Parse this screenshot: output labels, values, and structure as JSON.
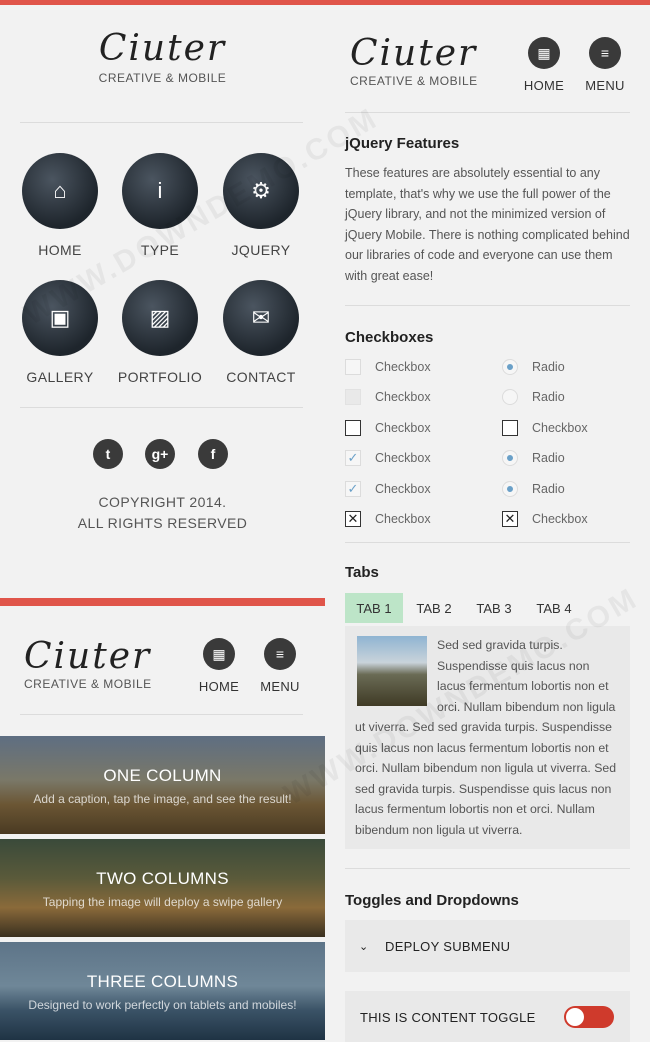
{
  "brand": {
    "logo": "Ciuter",
    "tagline": "CREATIVE & MOBILE"
  },
  "colors": {
    "accent": "#e0554a",
    "dark": "#3a3a3a",
    "tab_active": "#bde5c8",
    "toggle_on": "#cf3a2c",
    "check": "#6aa0c8"
  },
  "menu_tiles": [
    {
      "label": "HOME",
      "icon": "home-icon",
      "glyph": "⌂"
    },
    {
      "label": "TYPE",
      "icon": "info-icon",
      "glyph": "i"
    },
    {
      "label": "JQUERY",
      "icon": "gear-icon",
      "glyph": "⚙"
    },
    {
      "label": "GALLERY",
      "icon": "camera-icon",
      "glyph": "▣"
    },
    {
      "label": "PORTFOLIO",
      "icon": "image-icon",
      "glyph": "▨"
    },
    {
      "label": "CONTACT",
      "icon": "mail-icon",
      "glyph": "✉"
    }
  ],
  "social": [
    {
      "icon": "twitter-icon",
      "glyph": "t"
    },
    {
      "icon": "google-plus-icon",
      "glyph": "g+"
    },
    {
      "icon": "facebook-icon",
      "glyph": "f"
    }
  ],
  "footer": {
    "line1": "COPYRIGHT 2014.",
    "line2": "ALL RIGHTS RESERVED"
  },
  "header_nav": {
    "home": "HOME",
    "menu": "MENU"
  },
  "heroes": [
    {
      "title": "ONE COLUMN",
      "caption": "Add a caption, tap the image, and see the result!"
    },
    {
      "title": "TWO COLUMNS",
      "caption": "Tapping the image will deploy a swipe gallery"
    },
    {
      "title": "THREE COLUMNS",
      "caption": "Designed to work perfectly on tablets and mobiles!"
    }
  ],
  "jquery": {
    "title": "jQuery Features",
    "body": "These features are absolutely essential to any template, that's why we use the full power of the jQuery library, and not the minimized version of jQuery Mobile. There is nothing complicated behind our libraries of code and everyone can use them with great ease!"
  },
  "checkboxes": {
    "title": "Checkboxes",
    "left": [
      {
        "label": "Checkbox",
        "kind": "box-light",
        "checked": false
      },
      {
        "label": "Checkbox",
        "kind": "box-lightfill",
        "checked": false
      },
      {
        "label": "Checkbox",
        "kind": "box-dark",
        "checked": false
      },
      {
        "label": "Checkbox",
        "kind": "box-check",
        "checked": true
      },
      {
        "label": "Checkbox",
        "kind": "box-check",
        "checked": true
      },
      {
        "label": "Checkbox",
        "kind": "box-x",
        "checked": true
      }
    ],
    "right": [
      {
        "label": "Radio",
        "kind": "radio",
        "checked": true
      },
      {
        "label": "Radio",
        "kind": "radio",
        "checked": false
      },
      {
        "label": "Checkbox",
        "kind": "box-dark",
        "checked": false
      },
      {
        "label": "Radio",
        "kind": "radio",
        "checked": true
      },
      {
        "label": "Radio",
        "kind": "radio",
        "checked": true
      },
      {
        "label": "Checkbox",
        "kind": "box-x",
        "checked": true
      }
    ]
  },
  "tabs": {
    "title": "Tabs",
    "items": [
      "TAB 1",
      "TAB 2",
      "TAB 3",
      "TAB 4"
    ],
    "active_index": 0,
    "content": "Sed sed gravida turpis. Suspendisse quis lacus non lacus fermentum lobortis non et orci. Nullam bibendum non ligula ut viverra. Sed sed gravida turpis. Suspendisse quis lacus non lacus fermentum lobortis non et orci. Nullam bibendum non ligula ut viverra. Sed sed gravida turpis. Suspendisse quis lacus non lacus fermentum lobortis non et orci. Nullam bibendum non ligula ut viverra."
  },
  "toggles": {
    "title": "Toggles and Dropdowns",
    "submenu": "DEPLOY SUBMENU",
    "content_toggle": "THIS IS CONTENT TOGGLE",
    "toggle_on": true
  }
}
